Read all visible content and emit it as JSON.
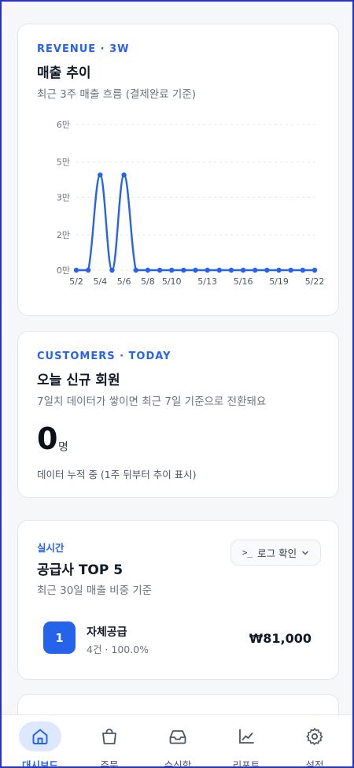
{
  "revenue_card": {
    "eyebrow": "REVENUE · 3W",
    "title": "매출 추이",
    "subtitle": "최근 3주 매출 흐름 (결제완료 기준)"
  },
  "chart_data": {
    "type": "line",
    "title": "",
    "xlabel": "",
    "ylabel": "",
    "y_ticks": [
      "0만",
      "2만",
      "3만",
      "5만",
      "6만"
    ],
    "y_tick_values": [
      0,
      15000,
      31000,
      46000,
      62000
    ],
    "ylim": [
      0,
      62000
    ],
    "x_tick_labels": [
      "5/2",
      "5/4",
      "5/6",
      "5/8",
      "5/10",
      "5/13",
      "5/16",
      "5/19",
      "5/22"
    ],
    "x_tick_indices": [
      0,
      2,
      4,
      6,
      8,
      11,
      14,
      17,
      20
    ],
    "x": [
      "5/2",
      "5/3",
      "5/4",
      "5/5",
      "5/6",
      "5/7",
      "5/8",
      "5/9",
      "5/10",
      "5/11",
      "5/12",
      "5/13",
      "5/14",
      "5/15",
      "5/16",
      "5/17",
      "5/18",
      "5/19",
      "5/20",
      "5/21",
      "5/22"
    ],
    "series": [
      {
        "values": [
          0,
          0,
          40500,
          0,
          40500,
          0,
          0,
          0,
          0,
          0,
          0,
          0,
          0,
          0,
          0,
          0,
          0,
          0,
          0,
          0,
          0
        ]
      }
    ],
    "grid": "horizontal-dashed",
    "line_color": "#2563eb"
  },
  "customers_card": {
    "eyebrow": "CUSTOMERS · TODAY",
    "title": "오늘 신규 회원",
    "subtitle": "7일치 데이터가 쌓이면 최근 7일 기준으로 전환돼요",
    "value": "0",
    "unit": "명",
    "note": "데이터 누적 중 (1주 뒤부터 추이 표시)"
  },
  "suppliers_card": {
    "eyebrow": "실시간",
    "title": "공급사 TOP 5",
    "subtitle": "최근 30일 매출 비중 기준",
    "log_button": {
      "prefix": ">_",
      "label": "로그 확인"
    },
    "items": [
      {
        "rank": "1",
        "name": "자체공급",
        "meta": "4건 · 100.0%",
        "amount": "₩81,000"
      }
    ]
  },
  "bottom_nav": [
    {
      "label": "대시보드",
      "icon": "home-icon",
      "active": true
    },
    {
      "label": "주문",
      "icon": "shopping-bag-icon",
      "active": false
    },
    {
      "label": "수신함",
      "icon": "inbox-icon",
      "active": false
    },
    {
      "label": "리포트",
      "icon": "chart-icon",
      "active": false
    },
    {
      "label": "설정",
      "icon": "gear-icon",
      "active": false
    }
  ],
  "colors": {
    "accent": "#2563eb",
    "accent_soft": "#dde8ff"
  }
}
